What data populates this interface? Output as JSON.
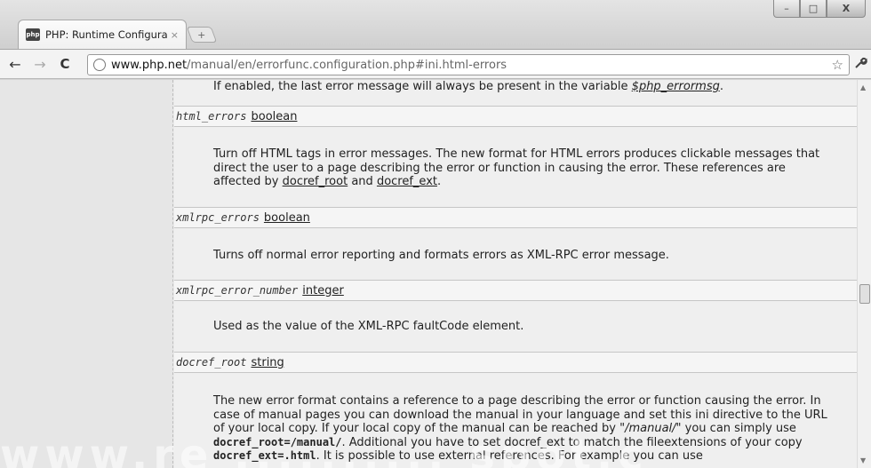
{
  "browser": {
    "tab": {
      "favicon": "php",
      "title": "PHP: Runtime Configurat...",
      "close": "×"
    },
    "new_tab": "+",
    "window_controls": {
      "minimize": "–",
      "maximize": "□",
      "close": "X"
    },
    "toolbar": {
      "back": "←",
      "forward": "→",
      "reload": "C",
      "url_host": "www.php.net",
      "url_path": "/manual/en/errorfunc.configuration.php#ini.html-errors",
      "star": "☆",
      "wrench": "🔧"
    }
  },
  "doc": {
    "intro_before": "If enabled, the last error message will always be present in the variable ",
    "intro_var": "$php_errormsg",
    "intro_after": ".",
    "html_errors": {
      "name": "html_errors",
      "type": "boolean",
      "desc_line1": "Turn off HTML tags in error messages. The new format for HTML errors produces clickable messages that",
      "desc_line2": "direct the user to a page describing the error or function in causing the error. These references are",
      "desc_line3_before": "affected by ",
      "link1": "docref_root",
      "and": " and ",
      "link2": "docref_ext",
      "desc_line3_after": "."
    },
    "xmlrpc_errors": {
      "name": "xmlrpc_errors",
      "type": "boolean",
      "desc": "Turns off normal error reporting and formats errors as XML-RPC error message."
    },
    "xmlrpc_error_number": {
      "name": "xmlrpc_error_number",
      "type": "integer",
      "desc": "Used as the value of the XML-RPC faultCode element."
    },
    "docref_root": {
      "name": "docref_root",
      "type": "string",
      "line1": "The new error format contains a reference to a page describing the error or function causing the error. In",
      "line2": "case of manual pages you can download the manual in your language and set this ini directive to the URL",
      "line3_before": "of your local copy. If your local copy of the manual can be reached by ",
      "line3_ital": "\"/manual/\"",
      "line3_after": " you can simply use",
      "line4_code": "docref_root=/manual/",
      "line4_after": ". Additional you have to set docref_ext to match the fileextensions of your copy",
      "line5_code": "docref_ext=.html",
      "line5_after": ". It is possible to use external references. For example you can use"
    }
  },
  "watermark": "www.re             ..........             spot.c"
}
